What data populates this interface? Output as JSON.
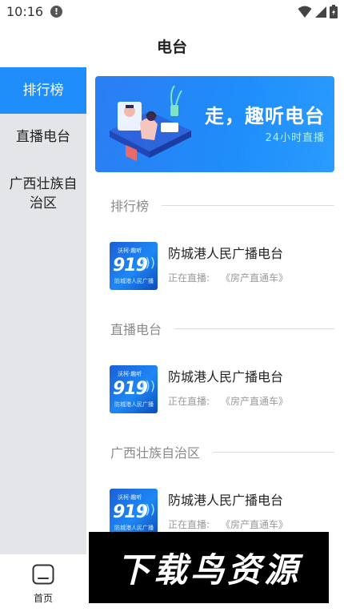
{
  "status_bar": {
    "time": "10:16",
    "alert_glyph": "!"
  },
  "header": {
    "title": "电台"
  },
  "sidebar": {
    "items": [
      {
        "label": "排行榜",
        "active": true
      },
      {
        "label": "直播电台",
        "active": false
      },
      {
        "label": "广西壮族自治区",
        "active": false
      }
    ]
  },
  "banner": {
    "title": "走，趣听电台",
    "subtitle": "24小时直播"
  },
  "sections": [
    {
      "label": "排行榜",
      "station": {
        "name": "防城港人民广播电台",
        "live_label": "正在直播:",
        "program": "《房产直通车》"
      }
    },
    {
      "label": "直播电台",
      "station": {
        "name": "防城港人民广播电台",
        "live_label": "正在直播:",
        "program": "《房产直通车》"
      }
    },
    {
      "label": "广西壮族自治区",
      "station": {
        "name": "防城港人民广播电台",
        "live_label": "正在直播:",
        "program": "《房产直通车》"
      }
    }
  ],
  "station_logo": {
    "number": "919",
    "top_text": "沃柯·趣听",
    "bottom_text": "防城港人民广播"
  },
  "bottom_nav": {
    "home_label": "首页"
  },
  "watermark": {
    "text": "下载鸟资源"
  },
  "colors": {
    "accent": "#1f8efa",
    "sidebar_bg": "#e3e5e9",
    "banner_sub": "#a7f0ff"
  },
  "icons": [
    "alert-icon",
    "wifi-icon",
    "signal-icon",
    "battery-icon",
    "home-icon"
  ]
}
